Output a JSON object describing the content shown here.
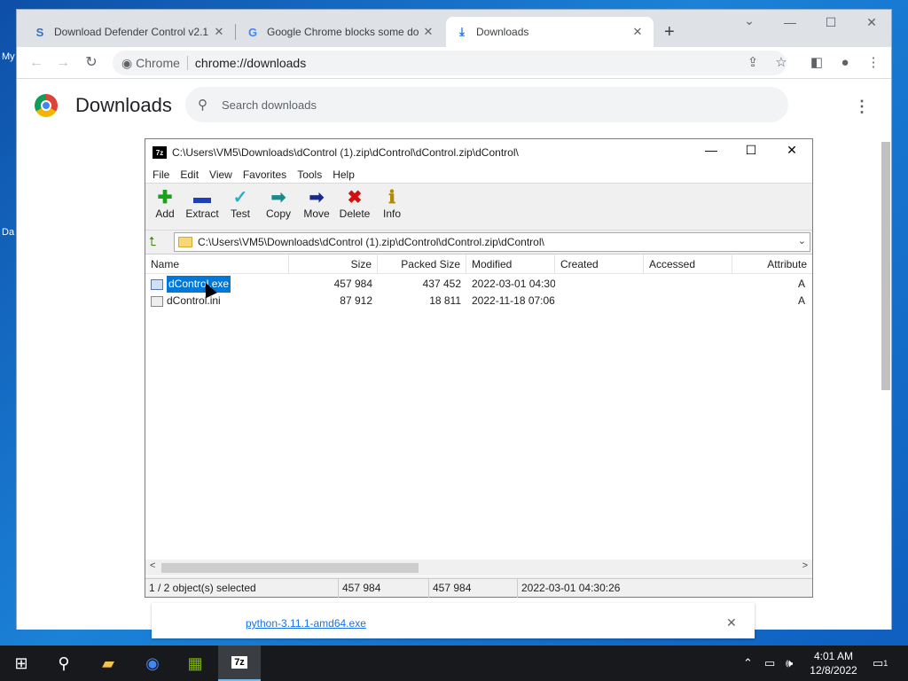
{
  "desktop": {
    "labels": [
      "My",
      "Da"
    ]
  },
  "browser": {
    "tabs": [
      {
        "title": "Download Defender Control v2.1",
        "icon": "S"
      },
      {
        "title": "Google Chrome blocks some do",
        "icon": "G"
      },
      {
        "title": "Downloads",
        "icon": "⤓"
      }
    ],
    "omnibox": {
      "chip": "Chrome",
      "url": "chrome://downloads"
    }
  },
  "downloads_page": {
    "title": "Downloads",
    "search_placeholder": "Search downloads",
    "item_link": "python-3.11.1-amd64.exe"
  },
  "sevenzip": {
    "title": "C:\\Users\\VM5\\Downloads\\dControl (1).zip\\dControl\\dControl.zip\\dControl\\",
    "menu": [
      "File",
      "Edit",
      "View",
      "Favorites",
      "Tools",
      "Help"
    ],
    "tools": [
      "Add",
      "Extract",
      "Test",
      "Copy",
      "Move",
      "Delete",
      "Info"
    ],
    "path": "C:\\Users\\VM5\\Downloads\\dControl (1).zip\\dControl\\dControl.zip\\dControl\\",
    "columns": [
      "Name",
      "Size",
      "Packed Size",
      "Modified",
      "Created",
      "Accessed",
      "Attribute"
    ],
    "rows": [
      {
        "name": "dControl.exe",
        "size": "457 984",
        "packed": "437 452",
        "modified": "2022-03-01 04:30",
        "attr": "A",
        "selected": true
      },
      {
        "name": "dControl.ini",
        "size": "87 912",
        "packed": "18 811",
        "modified": "2022-11-18 07:06",
        "attr": "A",
        "selected": false
      }
    ],
    "status": {
      "selection": "1 / 2 object(s) selected",
      "size": "457 984",
      "packed": "457 984",
      "modified": "2022-03-01 04:30:26"
    }
  },
  "taskbar": {
    "time": "4:01 AM",
    "date": "12/8/2022",
    "notification_count": "1",
    "sevenzip_label": "7z"
  }
}
